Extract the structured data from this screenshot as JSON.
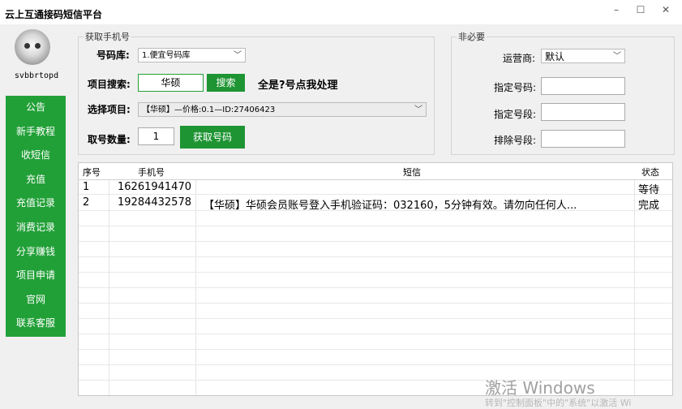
{
  "window": {
    "title": "云上互通接码短信平台",
    "minimize": "–",
    "maximize": "☐",
    "close": "✕"
  },
  "sidebar": {
    "username": "svbbrtopd",
    "menu": [
      "公告",
      "新手教程",
      "收短信",
      "充值",
      "充值记录",
      "消费记录",
      "分享赚钱",
      "项目申请",
      "官网",
      "联系客服"
    ]
  },
  "get_number": {
    "legend": "获取手机号",
    "library_label": "号码库:",
    "library_value": "1.便宜号码库",
    "search_label": "项目搜索:",
    "search_value": "华硕",
    "search_button": "搜索",
    "search_note": "全是?号点我处理",
    "project_label": "选择项目:",
    "project_value": "【华硕】—价格:0.1—ID:27406423",
    "count_label": "取号数量:",
    "count_value": "1",
    "get_button": "获取号码"
  },
  "optional": {
    "legend": "非必要",
    "carrier_label": "运营商:",
    "carrier_value": "默认",
    "number_label": "指定号码:",
    "number_value": "",
    "segment_label": "指定号段:",
    "segment_value": "",
    "exclude_label": "排除号段:",
    "exclude_value": ""
  },
  "table": {
    "headers": {
      "index": "序号",
      "phone": "手机号",
      "sms": "短信",
      "status": "状态"
    },
    "rows": [
      {
        "index": "1",
        "phone": "16261941470",
        "sms": "",
        "status": "等待"
      },
      {
        "index": "2",
        "phone": "19284432578",
        "sms": "【华硕】华硕会员账号登入手机验证码：032160，5分钟有效。请勿向任何人...",
        "status": "完成"
      }
    ]
  },
  "watermark": {
    "line1": "激活 Windows",
    "line2": "转到\"控制面板\"中的\"系统\"以激活 Wi"
  },
  "colors": {
    "accent": "#1e9432",
    "menu_bg": "#22a038"
  }
}
